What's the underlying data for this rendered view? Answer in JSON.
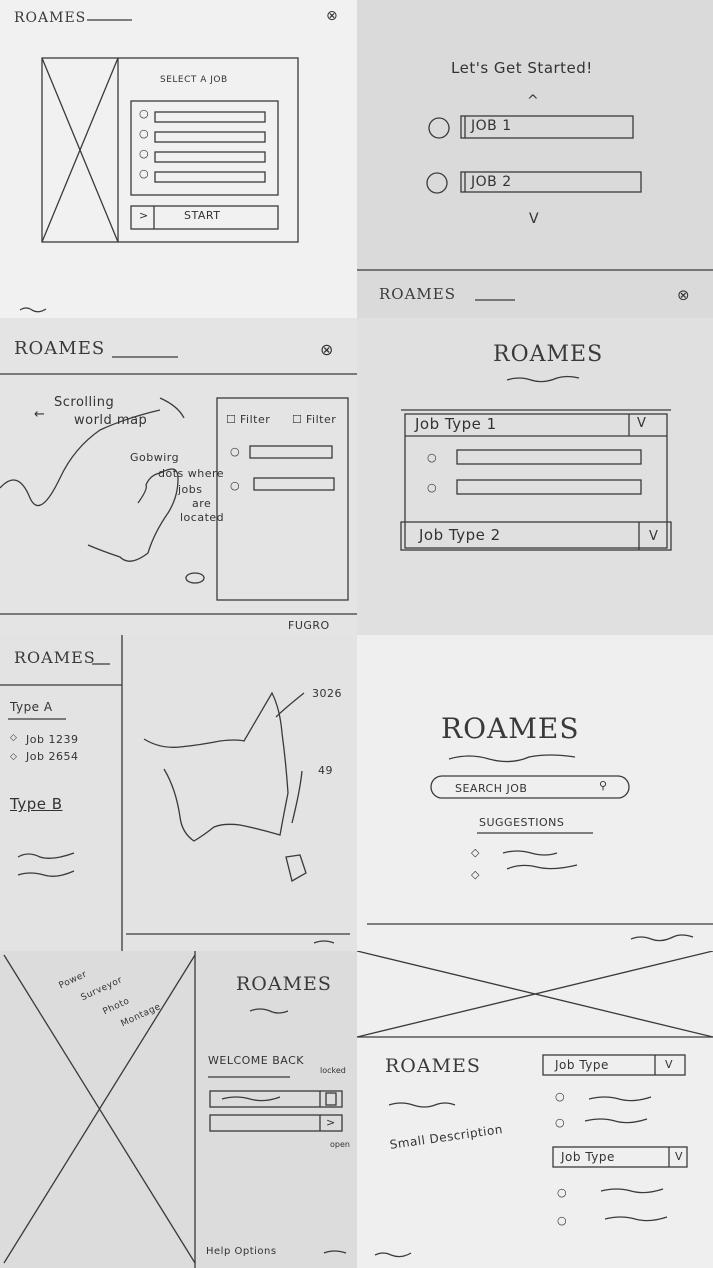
{
  "colors": {
    "panel_light": "#f2f1f1",
    "panel_mid": "#e5e5e5",
    "panel_dark": "#dadada",
    "ink": "#3a3a3a"
  },
  "sketch1": {
    "logo": "ROAMES",
    "close_icon": "close-icon",
    "select_label": "SELECT A JOB",
    "start_label": "START",
    "arrow_glyph": ">"
  },
  "sketch2": {
    "heading": "Let's Get Started!",
    "jobs": [
      "JOB 1",
      "JOB 2"
    ],
    "up_glyph": "^",
    "down_glyph": "V",
    "logo": "ROAMES"
  },
  "sketch3": {
    "logo": "ROAMES",
    "map_note": [
      "Scrolling",
      "world map"
    ],
    "map_note_arrow": "←",
    "pin_note": [
      "Gobwirg",
      "dots where",
      "jobs",
      "are",
      "located"
    ],
    "filters": [
      "Filter",
      "Filter"
    ],
    "brand": "FUGRO"
  },
  "sketch4": {
    "logo": "ROAMES",
    "job_types": [
      "Job Type 1",
      "Job Type 2"
    ],
    "dropdown_glyph": "V"
  },
  "sketch5": {
    "logo": "ROAMES",
    "type_a": "Type A",
    "jobs": [
      "Job 1239",
      "Job 2654"
    ],
    "type_b": "Type B",
    "counts": [
      "3026",
      "49"
    ]
  },
  "sketch6": {
    "logo": "ROAMES",
    "search_label": "SEARCH JOB",
    "search_icon": "search-icon",
    "suggestions_label": "SUGGESTIONS"
  },
  "sketch7": {
    "image_note": [
      "Power",
      "Surveyor",
      "Photo",
      "Montage"
    ],
    "logo": "ROAMES",
    "welcome": "WELCOME BACK",
    "locked_label": "locked",
    "open_label": "open",
    "help": "Help Options"
  },
  "sketch8": {
    "logo": "ROAMES",
    "description": "Small Description",
    "job_types": [
      "Job Type",
      "Job Type"
    ],
    "dropdown_glyph": "V"
  }
}
